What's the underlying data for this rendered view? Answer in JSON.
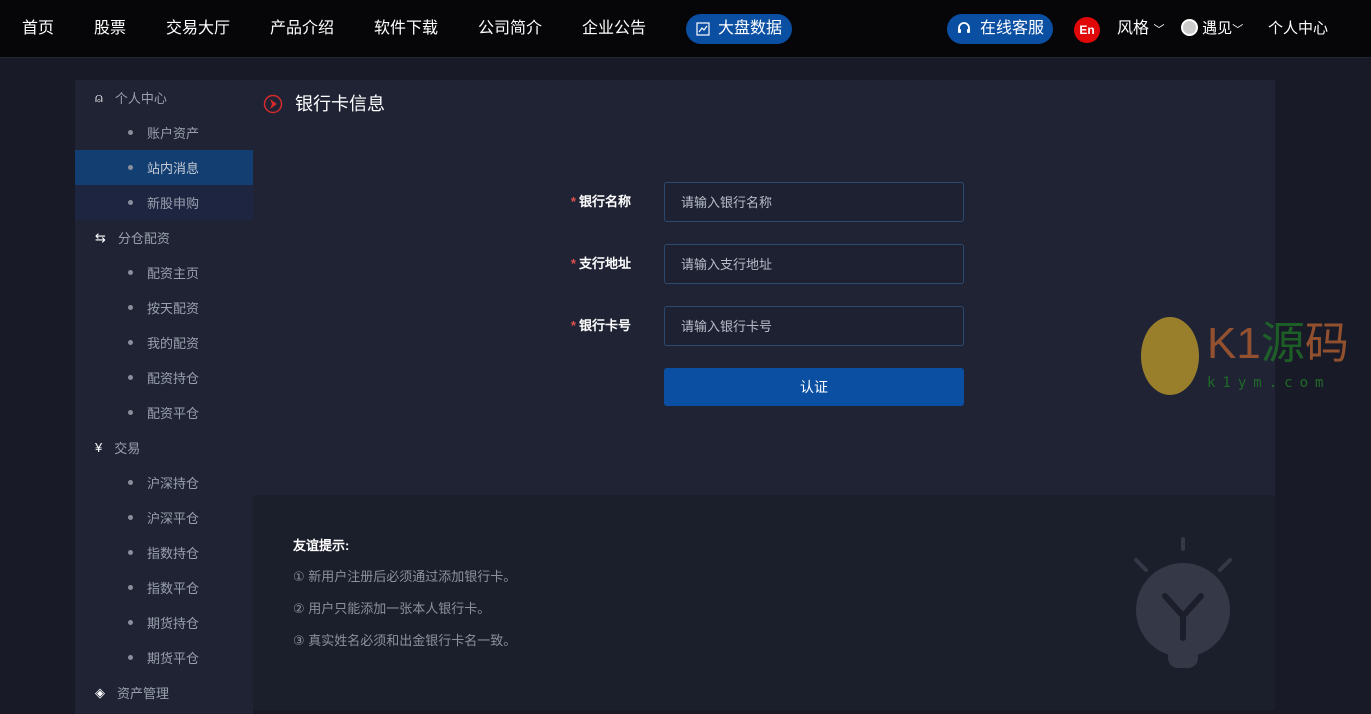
{
  "nav": {
    "items": [
      "首页",
      "股票",
      "交易大厅",
      "产品介绍",
      "软件下载",
      "公司简介",
      "企业公告"
    ],
    "big_data": "大盘数据",
    "service": "在线客服",
    "lang": "En",
    "style": "风格",
    "user": "遇见",
    "personal": "个人中心"
  },
  "sidebar": {
    "g1": "个人中心",
    "g1_items": [
      "账户资产",
      "站内消息",
      "新股申购"
    ],
    "g2": "分仓配资",
    "g2_items": [
      "配资主页",
      "按天配资",
      "我的配资",
      "配资持仓",
      "配资平仓"
    ],
    "g3": "交易",
    "g3_items": [
      "沪深持仓",
      "沪深平仓",
      "指数持仓",
      "指数平仓",
      "期货持仓",
      "期货平仓"
    ],
    "g4": "资产管理"
  },
  "main": {
    "title": "银行卡信息",
    "fields": [
      {
        "label": "银行名称",
        "placeholder": "请输入银行名称",
        "value": ""
      },
      {
        "label": "支行地址",
        "placeholder": "请输入支行地址",
        "value": ""
      },
      {
        "label": "银行卡号",
        "placeholder": "请输入银行卡号",
        "value": ""
      }
    ],
    "submit": "认证"
  },
  "tips": {
    "title": "友谊提示:",
    "items": [
      "① 新用户注册后必须通过添加银行卡。",
      "② 用户只能添加一张本人银行卡。",
      "③ 真实姓名必须和出金银行卡名一致。"
    ]
  },
  "watermark": {
    "brand": "K1源码",
    "url": "k1ym.com"
  },
  "colors": {
    "accent": "#0b4fa3",
    "required": "#e0524f",
    "lang_badge": "#e1080a"
  }
}
